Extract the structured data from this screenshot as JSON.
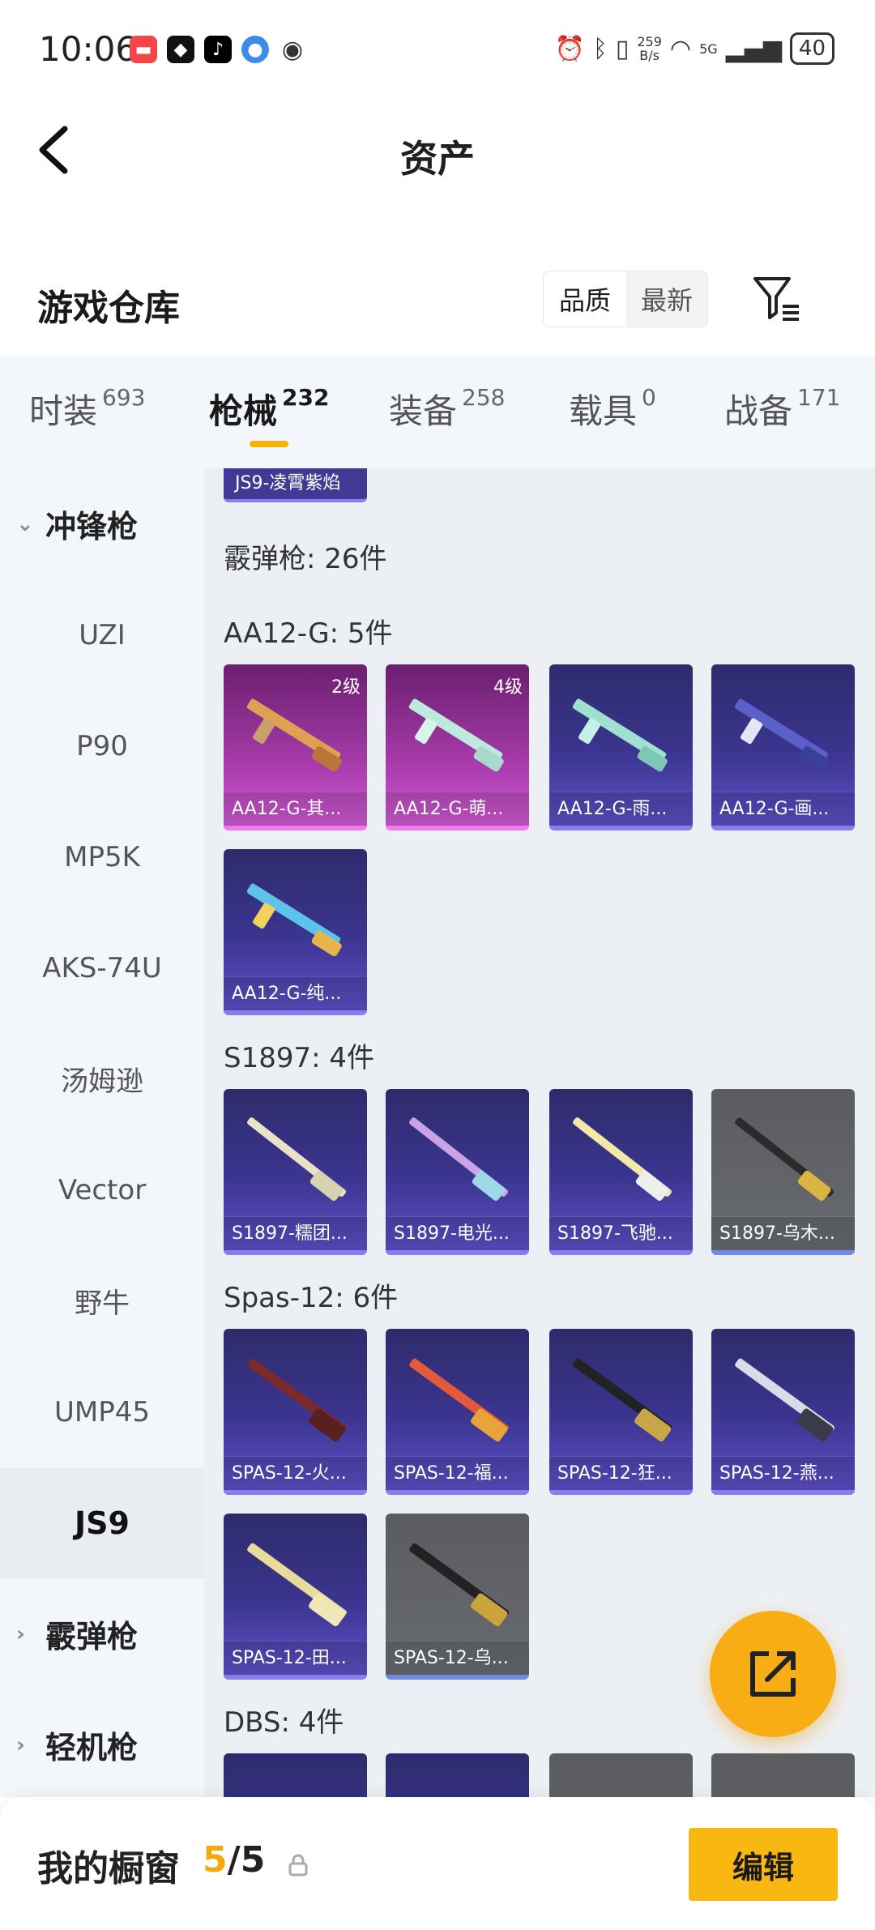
{
  "status_bar": {
    "time": "10:06",
    "net_speed_value": "259",
    "net_speed_unit": "B/s",
    "network": "5G",
    "battery": "40"
  },
  "header": {
    "title": "资产"
  },
  "warehouse": {
    "title": "游戏仓库",
    "sort_options": [
      "品质",
      "最新"
    ],
    "selected_sort": "品质"
  },
  "categories": [
    {
      "label": "时装",
      "count": "693"
    },
    {
      "label": "枪械",
      "count": "232"
    },
    {
      "label": "装备",
      "count": "258"
    },
    {
      "label": "载具",
      "count": "0"
    },
    {
      "label": "战备",
      "count": "171"
    }
  ],
  "selected_category": "枪械",
  "sidebar": {
    "groups": [
      {
        "label": "冲锋枪",
        "expanded": true
      },
      {
        "label": "霰弹枪",
        "expanded": false
      },
      {
        "label": "轻机枪",
        "expanded": false
      }
    ],
    "items": [
      "UZI",
      "P90",
      "MP5K",
      "AKS-74U",
      "汤姆逊",
      "Vector",
      "野牛",
      "UMP45",
      "JS9"
    ],
    "selected_item": "JS9"
  },
  "content": {
    "partial_top_card": "JS9-凌霄紫焰",
    "category_heading": "霰弹枪: 26件",
    "groups": [
      {
        "heading": "AA12-G: 5件",
        "cards": [
          {
            "name": "AA12-G-其...",
            "level": "2级",
            "rarity": "pink"
          },
          {
            "name": "AA12-G-萌...",
            "level": "4级",
            "rarity": "pink"
          },
          {
            "name": "AA12-G-雨...",
            "level": "",
            "rarity": "purple"
          },
          {
            "name": "AA12-G-画...",
            "level": "",
            "rarity": "purple"
          },
          {
            "name": "AA12-G-纯...",
            "level": "",
            "rarity": "purple"
          }
        ]
      },
      {
        "heading": "S1897: 4件",
        "cards": [
          {
            "name": "S1897-糯团...",
            "level": "",
            "rarity": "purple"
          },
          {
            "name": "S1897-电光...",
            "level": "",
            "rarity": "purple"
          },
          {
            "name": "S1897-飞驰...",
            "level": "",
            "rarity": "purple"
          },
          {
            "name": "S1897-乌木...",
            "level": "",
            "rarity": "gray"
          }
        ]
      },
      {
        "heading": "Spas-12: 6件",
        "cards": [
          {
            "name": "SPAS-12-火...",
            "level": "",
            "rarity": "purple"
          },
          {
            "name": "SPAS-12-福...",
            "level": "",
            "rarity": "purple"
          },
          {
            "name": "SPAS-12-狂...",
            "level": "",
            "rarity": "purple"
          },
          {
            "name": "SPAS-12-燕...",
            "level": "",
            "rarity": "purple"
          },
          {
            "name": "SPAS-12-田...",
            "level": "",
            "rarity": "purple"
          },
          {
            "name": "SPAS-12-乌...",
            "level": "",
            "rarity": "gray"
          }
        ]
      },
      {
        "heading": "DBS: 4件",
        "cards": []
      }
    ]
  },
  "bottom_bar": {
    "label": "我的橱窗",
    "current": "5",
    "total": "/5",
    "edit_label": "编辑"
  },
  "colors": {
    "accent": "#f9b712",
    "tab_underline": "#f6b10b",
    "card_purple": "#3b3590",
    "card_pink": "#a53aa8",
    "card_gray": "#676a70"
  }
}
